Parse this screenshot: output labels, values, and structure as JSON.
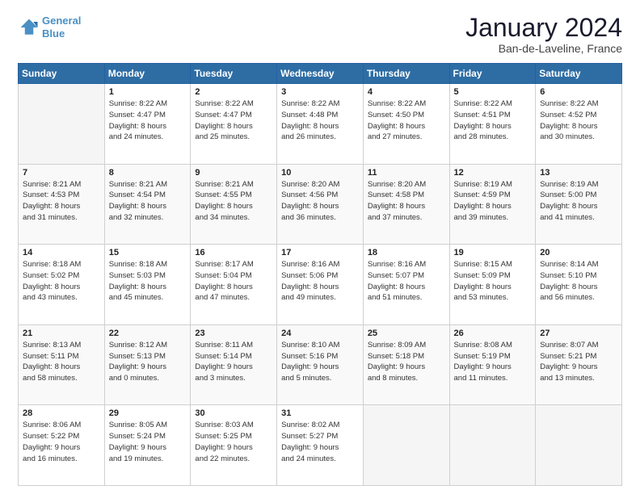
{
  "header": {
    "logo_line1": "General",
    "logo_line2": "Blue",
    "title": "January 2024",
    "subtitle": "Ban-de-Laveline, France"
  },
  "days_of_week": [
    "Sunday",
    "Monday",
    "Tuesday",
    "Wednesday",
    "Thursday",
    "Friday",
    "Saturday"
  ],
  "weeks": [
    [
      {
        "day": "",
        "info": ""
      },
      {
        "day": "1",
        "info": "Sunrise: 8:22 AM\nSunset: 4:47 PM\nDaylight: 8 hours\nand 24 minutes."
      },
      {
        "day": "2",
        "info": "Sunrise: 8:22 AM\nSunset: 4:47 PM\nDaylight: 8 hours\nand 25 minutes."
      },
      {
        "day": "3",
        "info": "Sunrise: 8:22 AM\nSunset: 4:48 PM\nDaylight: 8 hours\nand 26 minutes."
      },
      {
        "day": "4",
        "info": "Sunrise: 8:22 AM\nSunset: 4:50 PM\nDaylight: 8 hours\nand 27 minutes."
      },
      {
        "day": "5",
        "info": "Sunrise: 8:22 AM\nSunset: 4:51 PM\nDaylight: 8 hours\nand 28 minutes."
      },
      {
        "day": "6",
        "info": "Sunrise: 8:22 AM\nSunset: 4:52 PM\nDaylight: 8 hours\nand 30 minutes."
      }
    ],
    [
      {
        "day": "7",
        "info": "Sunrise: 8:21 AM\nSunset: 4:53 PM\nDaylight: 8 hours\nand 31 minutes."
      },
      {
        "day": "8",
        "info": "Sunrise: 8:21 AM\nSunset: 4:54 PM\nDaylight: 8 hours\nand 32 minutes."
      },
      {
        "day": "9",
        "info": "Sunrise: 8:21 AM\nSunset: 4:55 PM\nDaylight: 8 hours\nand 34 minutes."
      },
      {
        "day": "10",
        "info": "Sunrise: 8:20 AM\nSunset: 4:56 PM\nDaylight: 8 hours\nand 36 minutes."
      },
      {
        "day": "11",
        "info": "Sunrise: 8:20 AM\nSunset: 4:58 PM\nDaylight: 8 hours\nand 37 minutes."
      },
      {
        "day": "12",
        "info": "Sunrise: 8:19 AM\nSunset: 4:59 PM\nDaylight: 8 hours\nand 39 minutes."
      },
      {
        "day": "13",
        "info": "Sunrise: 8:19 AM\nSunset: 5:00 PM\nDaylight: 8 hours\nand 41 minutes."
      }
    ],
    [
      {
        "day": "14",
        "info": "Sunrise: 8:18 AM\nSunset: 5:02 PM\nDaylight: 8 hours\nand 43 minutes."
      },
      {
        "day": "15",
        "info": "Sunrise: 8:18 AM\nSunset: 5:03 PM\nDaylight: 8 hours\nand 45 minutes."
      },
      {
        "day": "16",
        "info": "Sunrise: 8:17 AM\nSunset: 5:04 PM\nDaylight: 8 hours\nand 47 minutes."
      },
      {
        "day": "17",
        "info": "Sunrise: 8:16 AM\nSunset: 5:06 PM\nDaylight: 8 hours\nand 49 minutes."
      },
      {
        "day": "18",
        "info": "Sunrise: 8:16 AM\nSunset: 5:07 PM\nDaylight: 8 hours\nand 51 minutes."
      },
      {
        "day": "19",
        "info": "Sunrise: 8:15 AM\nSunset: 5:09 PM\nDaylight: 8 hours\nand 53 minutes."
      },
      {
        "day": "20",
        "info": "Sunrise: 8:14 AM\nSunset: 5:10 PM\nDaylight: 8 hours\nand 56 minutes."
      }
    ],
    [
      {
        "day": "21",
        "info": "Sunrise: 8:13 AM\nSunset: 5:11 PM\nDaylight: 8 hours\nand 58 minutes."
      },
      {
        "day": "22",
        "info": "Sunrise: 8:12 AM\nSunset: 5:13 PM\nDaylight: 9 hours\nand 0 minutes."
      },
      {
        "day": "23",
        "info": "Sunrise: 8:11 AM\nSunset: 5:14 PM\nDaylight: 9 hours\nand 3 minutes."
      },
      {
        "day": "24",
        "info": "Sunrise: 8:10 AM\nSunset: 5:16 PM\nDaylight: 9 hours\nand 5 minutes."
      },
      {
        "day": "25",
        "info": "Sunrise: 8:09 AM\nSunset: 5:18 PM\nDaylight: 9 hours\nand 8 minutes."
      },
      {
        "day": "26",
        "info": "Sunrise: 8:08 AM\nSunset: 5:19 PM\nDaylight: 9 hours\nand 11 minutes."
      },
      {
        "day": "27",
        "info": "Sunrise: 8:07 AM\nSunset: 5:21 PM\nDaylight: 9 hours\nand 13 minutes."
      }
    ],
    [
      {
        "day": "28",
        "info": "Sunrise: 8:06 AM\nSunset: 5:22 PM\nDaylight: 9 hours\nand 16 minutes."
      },
      {
        "day": "29",
        "info": "Sunrise: 8:05 AM\nSunset: 5:24 PM\nDaylight: 9 hours\nand 19 minutes."
      },
      {
        "day": "30",
        "info": "Sunrise: 8:03 AM\nSunset: 5:25 PM\nDaylight: 9 hours\nand 22 minutes."
      },
      {
        "day": "31",
        "info": "Sunrise: 8:02 AM\nSunset: 5:27 PM\nDaylight: 9 hours\nand 24 minutes."
      },
      {
        "day": "",
        "info": ""
      },
      {
        "day": "",
        "info": ""
      },
      {
        "day": "",
        "info": ""
      }
    ]
  ]
}
